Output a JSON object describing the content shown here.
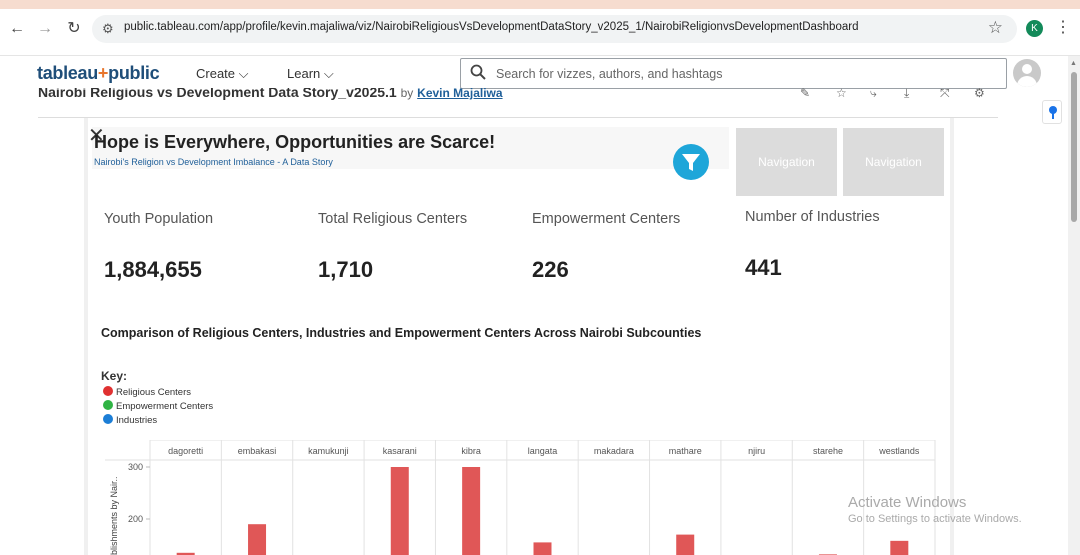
{
  "browser": {
    "url": "public.tableau.com/app/profile/kevin.majaliwa/viz/NairobiReligiousVsDevelopmentDataStory_v2025_1/NairobiReligionvsDevelopmentDashboard",
    "profile_initial": "K"
  },
  "header": {
    "logo_text": "tableau",
    "logo_plus": "+",
    "logo_suffix": "public",
    "menu": [
      {
        "label": "Create ⌵"
      },
      {
        "label": "Learn ⌵"
      }
    ],
    "search_placeholder": "Search for vizzes, authors, and hashtags"
  },
  "viz": {
    "title": "Nairobi Religious vs Development Data Story_v2025.1",
    "by": "by",
    "author": "Kevin Majaliwa"
  },
  "dashboard": {
    "close": "✕",
    "title": "Hope is Everywhere, Opportunities are Scarce!",
    "subtitle": "Nairobi's Religion vs Development Imbalance - A Data Story",
    "nav_buttons": [
      "Navigation",
      "Navigation"
    ],
    "kpis": [
      {
        "label": "Youth Population",
        "value": "1,884,655"
      },
      {
        "label": "Total Religious Centers",
        "value": "1,710"
      },
      {
        "label": "Empowerment Centers",
        "value": "226"
      },
      {
        "label": "Number of Industries",
        "value": "441"
      }
    ],
    "chart_title": "Comparison of Religious Centers, Industries and Empowerment Centers Across Nairobi Subcounties",
    "key_title": "Key:",
    "legend": [
      {
        "label": "Religious Centers",
        "color": "#e03131"
      },
      {
        "label": "Empowerment Centers",
        "color": "#2fb344"
      },
      {
        "label": "Industries",
        "color": "#1c7ed6"
      }
    ]
  },
  "chart_data": {
    "type": "bar",
    "categories": [
      "dagoretti",
      "embakasi",
      "kamukunji",
      "kasarani",
      "kibra",
      "langata",
      "makadara",
      "mathare",
      "njiru",
      "starehe",
      "westlands"
    ],
    "series": [
      {
        "name": "Religious Centers",
        "values": [
          135,
          190,
          null,
          300,
          300,
          155,
          null,
          170,
          null,
          132,
          158
        ]
      }
    ],
    "ylabel": "blishments by Nair..",
    "yticks": [
      200,
      300
    ],
    "bar_color": "#e05757"
  },
  "watermark": {
    "line1": "Activate Windows",
    "line2": "Go to Settings to activate Windows."
  }
}
